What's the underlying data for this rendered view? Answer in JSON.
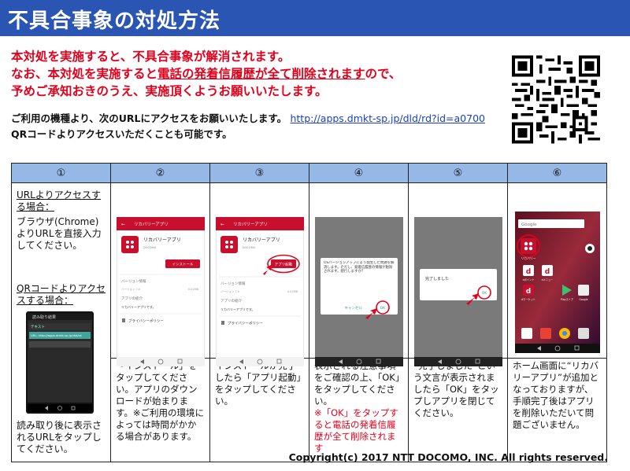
{
  "title": "不具合事象の対処方法",
  "warning": {
    "line1": "本対処を実施すると、不具合事象が解消されます。",
    "line2a": "なお、本対処を実施すると",
    "line2b": "電話の発着信履歴が全て削除されます",
    "line2c": "ので、",
    "line3": "予めご承知おきのうえ、実施頂くようお願いいたします。"
  },
  "access": {
    "line1": "ご利用の機種より、次のURLにアクセスをお願いいたします。",
    "url": "http://apps.dmkt-sp.jp/dld/rd?id=a0700",
    "line2": "QRコードよりアクセスいただくことも可能です。"
  },
  "steps": {
    "headers": [
      "①",
      "②",
      "③",
      "④",
      "⑤",
      "⑥"
    ],
    "col1": {
      "url_heading": "URLよりアクセスする場合：",
      "url_body": "ブラウザ(Chrome)よりURLを直接入力してください。",
      "qr_heading": "QRコードよりアクセスする場合：",
      "qr_body": "読み取り後に表示されるURLをタップしてください。",
      "screen_title": "読み取り結果",
      "screen_sub": "テキスト",
      "screen_url": "URL: http://apps.dmkt-sp.jp/dld/rd"
    },
    "texts": [
      "「インストール」をタップしてください。アプリのダウンロードが始まります。※ご利用の環境によっては時間がかかる場合があります。",
      "インストールが完了したら「アプリ起動」をタップしてください。",
      "表示される注意事項をご確認の上、「OK」をタップしてください。",
      "“完了しました”という文言が表示されましたら「OK」をタップしアプリを閉じてください。",
      "ホーム画面に“リカバリーアプリ”が追加となっておりますが、手順完了後はアプリを削除いただいて問題ございません。"
    ],
    "step4_red": "※「OK」をタップすると電話の発着信履歴が全て削除されます",
    "screen2": {
      "bar": "リカバリーアプリ",
      "app": "リカバリーアプリ",
      "company": "DOCOMO",
      "button": "インストール",
      "version_hd": "バージョン情報",
      "version": "バージョン 7.0",
      "size": "0.02MB",
      "intro_hd": "アプリの紹介",
      "intro": "リカバリーアプリです。",
      "privacy": "プライバシーポリシー"
    },
    "screen3": {
      "bar": "リカバリーアプリ",
      "app": "リカバリーアプリ",
      "company": "DOCOMO",
      "button": "アプリ起動",
      "version_hd": "バージョン情報",
      "version": "バージョン 7.0",
      "size": "0.02MB",
      "intro_hd": "アプリの紹介",
      "intro": "リカバリーアプリです。",
      "privacy": "プライバシーポリシー"
    },
    "screen4": {
      "msg": "OSバージョンアップにより発生した問題を解消します。ただし、発着信履歴の情報が削除されます。続行しますか？",
      "cancel": "キャンセル",
      "ok": "OK"
    },
    "screen5": {
      "msg": "完了しました",
      "ok": "OK"
    },
    "screen6": {
      "search": "Google",
      "app_label": "リカバリー",
      "apps": [
        "dポイント",
        "dメニュー",
        "dマーケット",
        "Playストア",
        "Google"
      ]
    }
  },
  "copyright": "Copyright(c) 2017 NTT DOCOMO, INC. All rights reserved.",
  "colors": {
    "title_bar": "#2b55b3",
    "warning": "#e3001b",
    "header_cell": "#96b8e6",
    "app_red": "#c8102e"
  }
}
